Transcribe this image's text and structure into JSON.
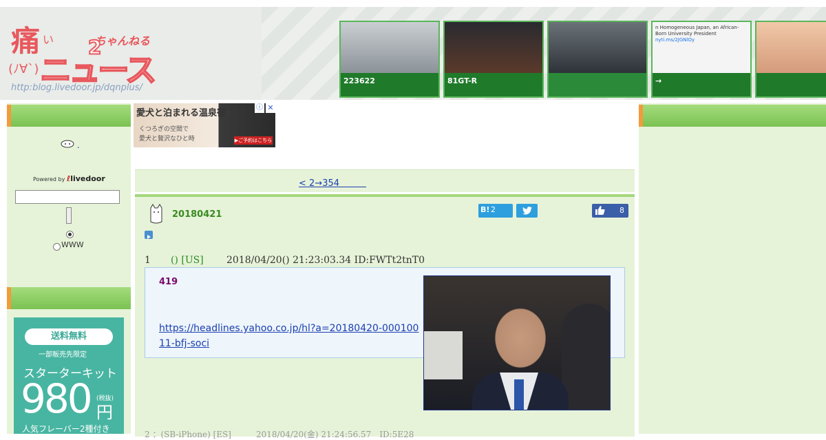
{
  "header": {
    "logo": {
      "kanji": "痛",
      "small_i": "い",
      "chan": "ちゃんねる",
      "face": "(ﾉ∀`)",
      "nyus": "ニュース",
      "two": "2",
      "url": "http:blog.livedoor.jp/dqnplus/"
    },
    "thumbnails": [
      {
        "caption": "223622",
        "color": "#8a9196"
      },
      {
        "caption": "81GT-R",
        "color": "#3b2b26"
      },
      {
        "caption": "",
        "color": "#3a4147"
      },
      {
        "caption": "→",
        "headline": "n Homogeneous Japan, an African-Born University President",
        "sub": "nyti.ms/2JGNlOy",
        "color": "#f4f4f4"
      },
      {
        "caption": "",
        "color": "#e7b59a"
      }
    ]
  },
  "ad": {
    "title": "愛犬と泊まれる温泉宿",
    "line1": "くつろぎの空間で",
    "line2": "愛犬と贅沢なひと時",
    "badge": "▶ご予約はこちら",
    "close": "✕",
    "info": "ⓘ"
  },
  "left": {
    "category_link": ".",
    "powered_by": "Powered by",
    "powered_brand": "livedoor",
    "radio_www": "WWW",
    "promo": {
      "pill": "送料無料",
      "limit": "一部販売先限定",
      "kit": "スターターキット",
      "price": "980",
      "yen": "円",
      "tax": "(税抜)",
      "flavor": "人気フレーバー2種付き"
    }
  },
  "nav": {
    "link": "< 2→354　　　"
  },
  "article": {
    "title": "20180421",
    "hatena_label": "B!",
    "hatena_count": "2",
    "twitter_label": "🐦",
    "like_count": "8",
    "meta": {
      "num": "1",
      "name": "() [US]",
      "datetime": "2018/04/20() 21:23:03.34 ID:FWTt2tnT0"
    },
    "post": {
      "score": "419",
      "link": "https://headlines.yahoo.co.jp/hl?a=20180420-00010011-bfj-soci"
    },
    "next_meta": "2 ：(SB-iPhone) [ES]　　　2018/04/20(金) 21:24:56.57　ID:5E28"
  }
}
